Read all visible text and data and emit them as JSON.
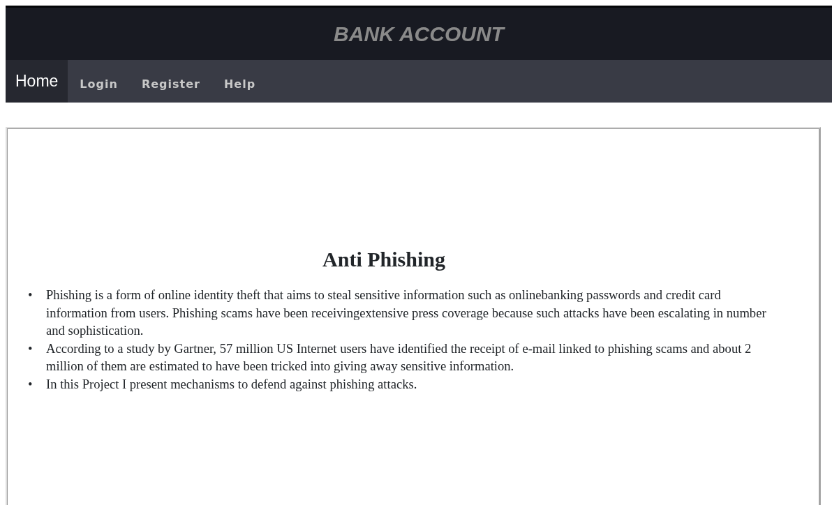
{
  "header": {
    "title": "BANK ACCOUNT"
  },
  "nav": [
    {
      "label": "Home",
      "selected": true
    },
    {
      "label": "Login",
      "selected": false
    },
    {
      "label": "Register",
      "selected": false
    },
    {
      "label": "Help",
      "selected": false
    }
  ],
  "content": {
    "heading": "Anti Phishing",
    "bullets": [
      {
        "marker": "•",
        "text": "Phishing is a form of online identity theft that aims to steal sensitive information such as onlinebanking passwords and credit card information from users. Phishing scams have been receivingextensive press coverage because such attacks have been escalating in number and sophistication."
      },
      {
        "marker": "•",
        "text": "According to a study by Gartner, 57 million US Internet users have identified the receipt of e-mail linked to phishing scams and about 2 million of them are estimated to have been tricked into giving away sensitive information."
      },
      {
        "marker": "•",
        "text": "In this Project I present mechanisms to defend against phishing attacks."
      }
    ]
  }
}
